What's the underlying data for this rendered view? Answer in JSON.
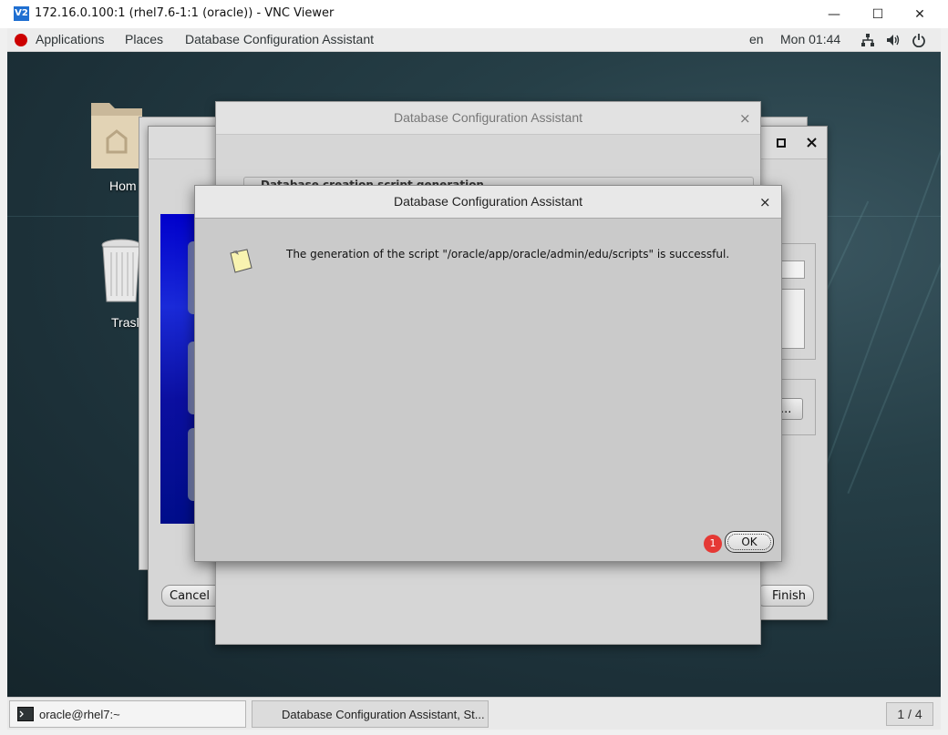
{
  "vnc": {
    "logo": "V2",
    "title": "172.16.0.100:1 (rhel7.6-1:1 (oracle)) - VNC Viewer",
    "minimize": "—",
    "maximize": "☐",
    "close": "✕"
  },
  "topbar": {
    "applications": "Applications",
    "places": "Places",
    "active_app": "Database Configuration Assistant",
    "language": "en",
    "clock": "Mon 01:44"
  },
  "desktop": {
    "icons": [
      {
        "label": "Hom"
      },
      {
        "label": "Trasl"
      }
    ]
  },
  "back_window": {
    "cancel_label": "Cancel",
    "finish_label": "Finish",
    "browse_label": "e..."
  },
  "mid_window": {
    "title": "Database Configuration Assistant",
    "close": "×",
    "section_text": "Database creation script generation"
  },
  "dialog": {
    "title": "Database Configuration Assistant",
    "close": "×",
    "message": "The generation of the script \"/oracle/app/oracle/admin/edu/scripts\" is successful.",
    "ok_label": "OK",
    "badge": "1"
  },
  "taskbar": {
    "terminal_label": "oracle@rhel7:~",
    "dbca_label": "Database Configuration Assistant, St...",
    "workspace": "1 / 4"
  },
  "icons": {
    "network": "network-icon",
    "volume": "volume-icon",
    "power": "power-icon",
    "folder": "home-folder-icon",
    "trash": "trash-icon",
    "info": "note-icon",
    "terminal": "terminal-icon"
  }
}
